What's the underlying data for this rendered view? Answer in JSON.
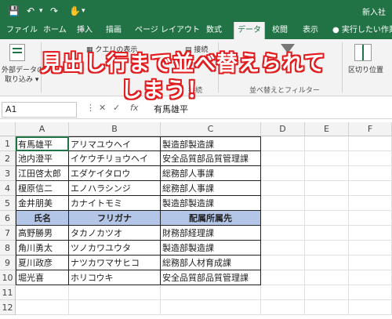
{
  "title_right": "新入社",
  "tabs": [
    "ファイル",
    "ホーム",
    "挿入",
    "描画",
    "ページ レイアウト",
    "数式",
    "データ",
    "校閲",
    "表示",
    "実行したい作業を"
  ],
  "active_tab": "データ",
  "ribbon": {
    "get_external": "外部データの",
    "get_external2": "取り込み",
    "query_show": "クエリの表示",
    "connect": "接続",
    "split": "区切り位置",
    "group_sort_filter": "並べ替えとフィルター",
    "group_connect": "接続"
  },
  "callout": {
    "line1": "見出し行まで並べ替えられて",
    "line2": "しまう！"
  },
  "formula_bar": {
    "name_box": "A1",
    "fx": "fx",
    "value": "有馬雄平"
  },
  "columns": [
    "A",
    "B",
    "C",
    "D",
    "E",
    "F"
  ],
  "rows": [
    {
      "n": "1",
      "a": "有馬雄平",
      "b": "アリマユウヘイ",
      "c": "製造部製造課"
    },
    {
      "n": "2",
      "a": "池内澄平",
      "b": "イケウチリョウヘイ",
      "c": "安全品質部品質管理課"
    },
    {
      "n": "3",
      "a": "江田啓太郎",
      "b": "エダケイタロウ",
      "c": "総務部人事課"
    },
    {
      "n": "4",
      "a": "榎原信二",
      "b": "エノハラシンジ",
      "c": "総務部人事課"
    },
    {
      "n": "5",
      "a": "金井朋美",
      "b": "カナイトモミ",
      "c": "製造部製造課"
    },
    {
      "n": "6",
      "a": "氏名",
      "b": "フリガナ",
      "c": "配属所属先"
    },
    {
      "n": "7",
      "a": "高野勝男",
      "b": "タカノカツオ",
      "c": "財務部経理課"
    },
    {
      "n": "8",
      "a": "角川勇太",
      "b": "ツノカワユウタ",
      "c": "製造部製造課"
    },
    {
      "n": "9",
      "a": "夏川政彦",
      "b": "ナツカワマサヒコ",
      "c": "総務部人材育成課"
    },
    {
      "n": "10",
      "a": "堀光喜",
      "b": "ホリコウキ",
      "c": "安全品質部品質管理課"
    },
    {
      "n": "11",
      "a": "",
      "b": "",
      "c": ""
    },
    {
      "n": "12",
      "a": "",
      "b": "",
      "c": ""
    }
  ],
  "colors": {
    "excel_green": "#217346",
    "header_fill": "#b4c6e7",
    "callout_red": "#e11d20"
  }
}
